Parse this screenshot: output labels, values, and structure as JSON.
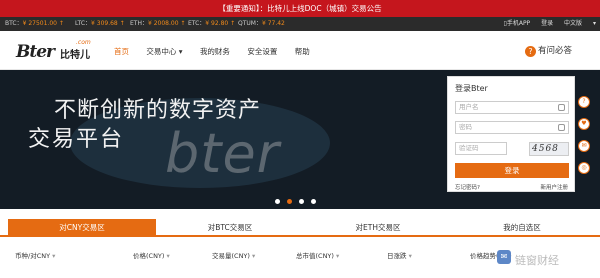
{
  "notice": "【重要通知】：比特儿上线DOC（城镇）交易公告",
  "ticker": [
    {
      "name": "BTC：",
      "value": "¥ 27501.00 ↑"
    },
    {
      "name": "LTC：",
      "value": "¥ 309.68 ↑"
    },
    {
      "name": "ETH：",
      "value": "¥ 2008.00 ↑"
    },
    {
      "name": "ETC：",
      "value": "¥ 92.80 ↑"
    },
    {
      "name": "QTUM：",
      "value": "¥ 77.42"
    }
  ],
  "topbar": {
    "app": "▯手机APP",
    "login": "登录",
    "lang": "中文版",
    "more": "▾"
  },
  "logo": {
    "mark": "Bter",
    "cn": "比特儿",
    "com": ".com"
  },
  "menu": [
    "首页",
    "交易中心 ▾",
    "我的财务",
    "安全设置",
    "帮助"
  ],
  "help": {
    "icon": "?",
    "label": "有问必答"
  },
  "banner": {
    "line1": "不断创新的数字资产",
    "line2": "交易平台",
    "word": "bter"
  },
  "login": {
    "title": "登录Bter",
    "username_placeholder": "用户名",
    "password_placeholder": "密码",
    "code_placeholder": "验证码",
    "captcha": "4568",
    "button": "登录",
    "forgot": "忘记密码?",
    "register": "新用户注册"
  },
  "side": [
    "?",
    "♥",
    "✉",
    "◎"
  ],
  "tabs": [
    "对CNY交易区",
    "对BTC交易区",
    "对ETH交易区",
    "我的自选区"
  ],
  "columns": [
    "币种/对CNY",
    "价格(CNY)",
    "交易量(CNY)",
    "总市值(CNY)",
    "日涨跌",
    "价格趋势(3日)"
  ],
  "watermark": "链窗财经",
  "chat_icon": "✉"
}
